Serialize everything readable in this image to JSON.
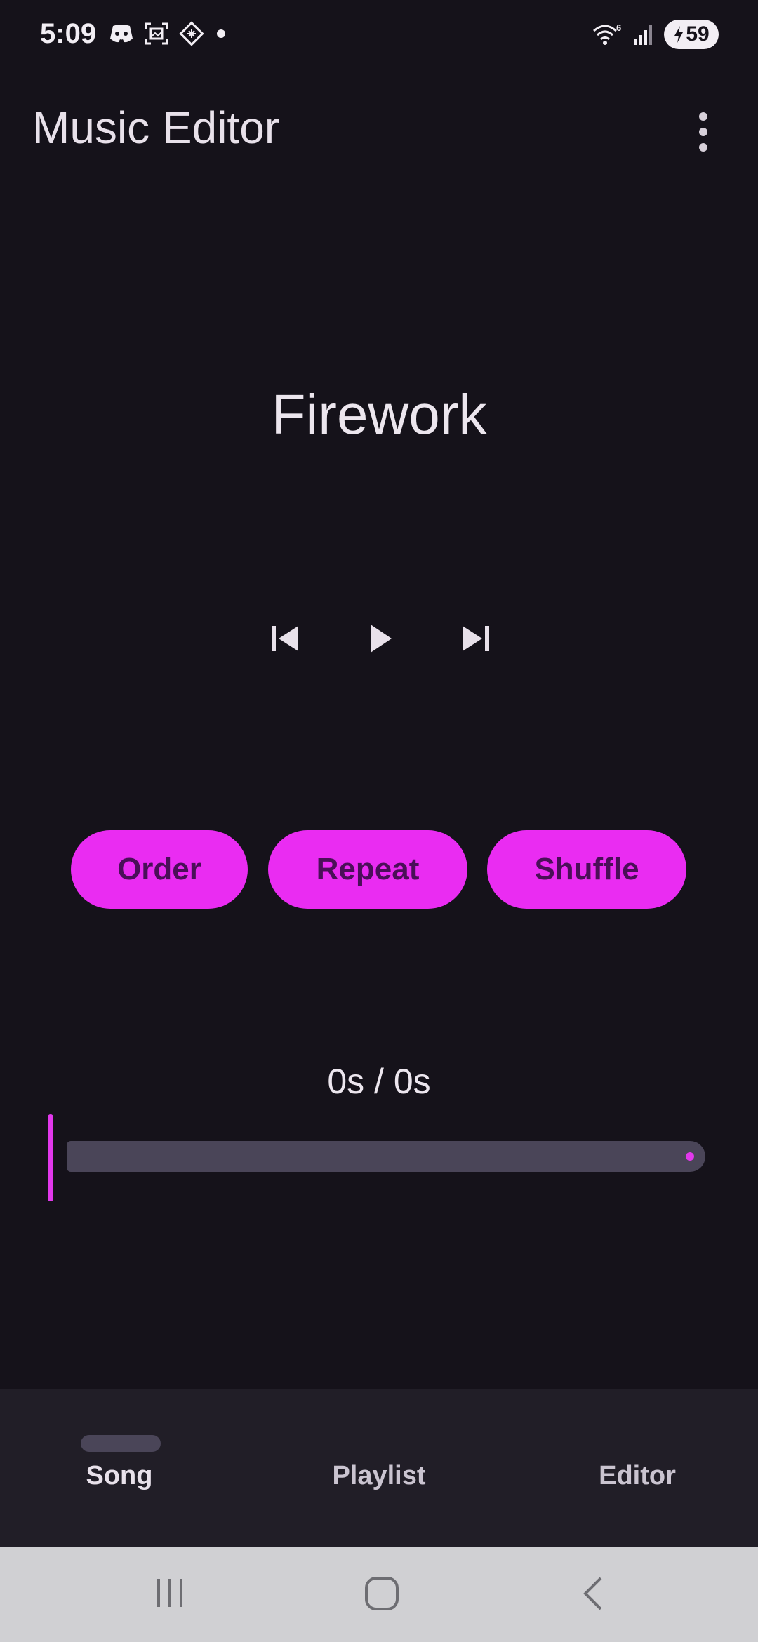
{
  "status_bar": {
    "time": "5:09",
    "battery_level": "59",
    "left_icons": [
      "discord-icon",
      "screenshot-icon",
      "app-icon",
      "notification-dot-icon"
    ],
    "right_icons": [
      "wifi-6-icon",
      "signal-icon",
      "battery-charging-icon"
    ]
  },
  "app_bar": {
    "title": "Music Editor",
    "overflow_icon": "more-vert-icon"
  },
  "player": {
    "song_title": "Firework",
    "controls": [
      "skip-previous-icon",
      "play-icon",
      "skip-next-icon"
    ]
  },
  "modes": {
    "order_label": "Order",
    "repeat_label": "Repeat",
    "shuffle_label": "Shuffle"
  },
  "progress": {
    "time_text": "0s / 0s",
    "fraction": 0
  },
  "bottom_nav": {
    "items": [
      {
        "label": "Song",
        "selected": true
      },
      {
        "label": "Playlist",
        "selected": false
      },
      {
        "label": "Editor",
        "selected": false
      }
    ]
  },
  "system_nav": {
    "buttons": [
      "recent-apps-icon",
      "home-icon",
      "back-icon"
    ]
  },
  "colors": {
    "background": "#15121a",
    "accent": "#ea2cf2",
    "accent_text": "#4a0f58",
    "nav_background": "#211e27",
    "system_nav_background": "#d0d0d3"
  }
}
